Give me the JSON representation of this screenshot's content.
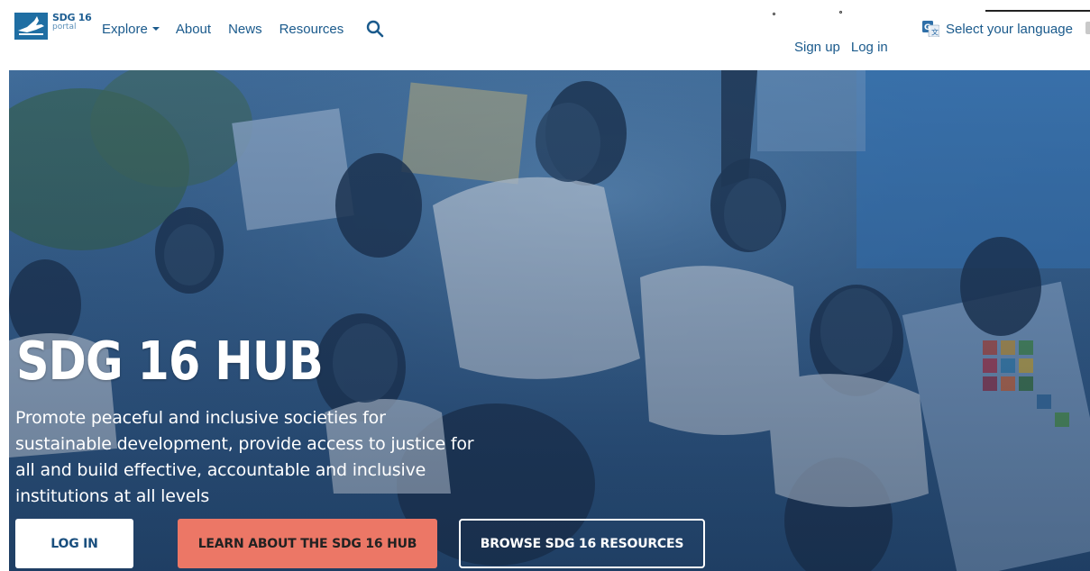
{
  "header": {
    "logo": {
      "line1": "SDG 16",
      "line2": "portal",
      "icon": "dove-icon",
      "color": "#1f6ea3"
    },
    "nav": [
      {
        "label": "Explore",
        "has_dropdown": true
      },
      {
        "label": "About"
      },
      {
        "label": "News"
      },
      {
        "label": "Resources"
      }
    ],
    "search_icon": "search-icon",
    "auth": {
      "signup": "Sign up",
      "login": "Log in"
    },
    "language": {
      "label": "Select your language",
      "icon": "google-translate-icon"
    },
    "link_color": "#1a5a8c"
  },
  "hero": {
    "title": "SDG 16 HUB",
    "description": "Promote peaceful and inclusive societies for sustainable development, provide access to justice for all and build effective, accountable and inclusive institutions at all levels",
    "buttons": {
      "login": "LOG IN",
      "learn": "LEARN ABOUT THE SDG 16 HUB",
      "browse": "BROWSE SDG 16 RESOURCES"
    },
    "colors": {
      "learn_button": "#ec7766",
      "login_button_text": "#1a4f7e"
    }
  }
}
